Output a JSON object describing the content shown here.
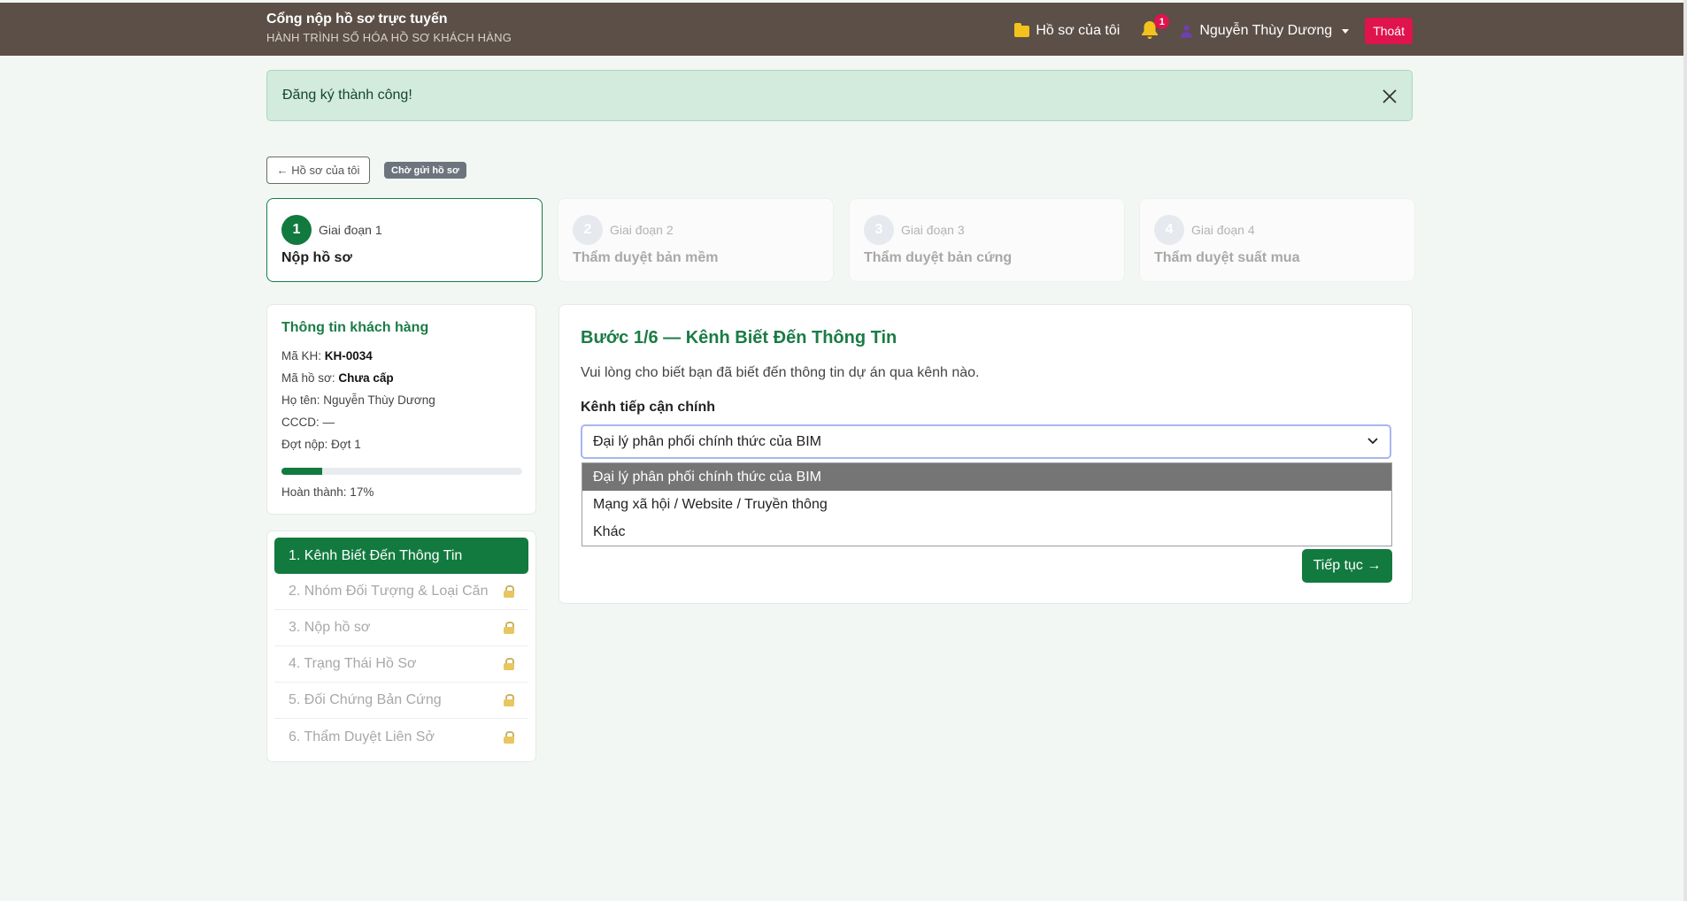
{
  "navbar": {
    "brand_title": "Cổng nộp hồ sơ trực tuyến",
    "brand_subtitle": "HÀNH TRÌNH SỐ HÓA HỒ SƠ KHÁCH HÀNG",
    "my_files": "Hồ sơ của tôi",
    "notification_count": "1",
    "user_name": "Nguyễn Thùy Dương",
    "logout": "Thoát"
  },
  "alert": {
    "message": "Đăng ký thành công!"
  },
  "back_button": "← Hồ sơ của tôi",
  "status_badge": "Chờ gửi hồ sơ",
  "stages": [
    {
      "num": "1",
      "label": "Giai đoạn 1",
      "title": "Nộp hồ sơ",
      "active": true
    },
    {
      "num": "2",
      "label": "Giai đoạn 2",
      "title": "Thẩm duyệt bản mềm",
      "active": false
    },
    {
      "num": "3",
      "label": "Giai đoạn 3",
      "title": "Thẩm duyệt bản cứng",
      "active": false
    },
    {
      "num": "4",
      "label": "Giai đoạn 4",
      "title": "Thẩm duyệt suất mua",
      "active": false
    }
  ],
  "customer": {
    "title": "Thông tin khách hàng",
    "code_label": "Mã KH:",
    "code_value": "KH-0034",
    "file_label": "Mã hồ sơ:",
    "file_value": "Chưa cấp",
    "name_label": "Họ tên:",
    "name_value": "Nguyễn Thùy Dương",
    "id_label": "CCCD:",
    "id_value": "—",
    "round_label": "Đợt nộp:",
    "round_value": "Đợt 1",
    "progress_percent": 17,
    "progress_text": "Hoàn thành: 17%"
  },
  "steps": [
    {
      "label": "1. Kênh Biết Đến Thông Tin",
      "active": true,
      "locked": false
    },
    {
      "label": "2. Nhóm Đối Tượng & Loại Căn",
      "active": false,
      "locked": true
    },
    {
      "label": "3. Nộp hồ sơ",
      "active": false,
      "locked": true
    },
    {
      "label": "4. Trạng Thái Hồ Sơ",
      "active": false,
      "locked": true
    },
    {
      "label": "5. Đối Chứng Bản Cứng",
      "active": false,
      "locked": true
    },
    {
      "label": "6. Thẩm Duyệt Liên Sở",
      "active": false,
      "locked": true
    }
  ],
  "form": {
    "title": "Bước 1/6 — Kênh Biết Đến Thông Tin",
    "description": "Vui lòng cho biết bạn đã biết đến thông tin dự án qua kênh nào.",
    "field_label": "Kênh tiếp cận chính",
    "selected_value": "Đại lý phân phối chính thức của BIM",
    "options": [
      "Đại lý phân phối chính thức của BIM",
      "Mạng xã hội / Website / Truyền thông",
      "Khác"
    ],
    "next_button": "Tiếp tục →"
  },
  "colors": {
    "navbar": "#5b4f47",
    "primary": "#127a3f",
    "danger": "#e0144c",
    "alert_bg": "#d2ebdd"
  }
}
